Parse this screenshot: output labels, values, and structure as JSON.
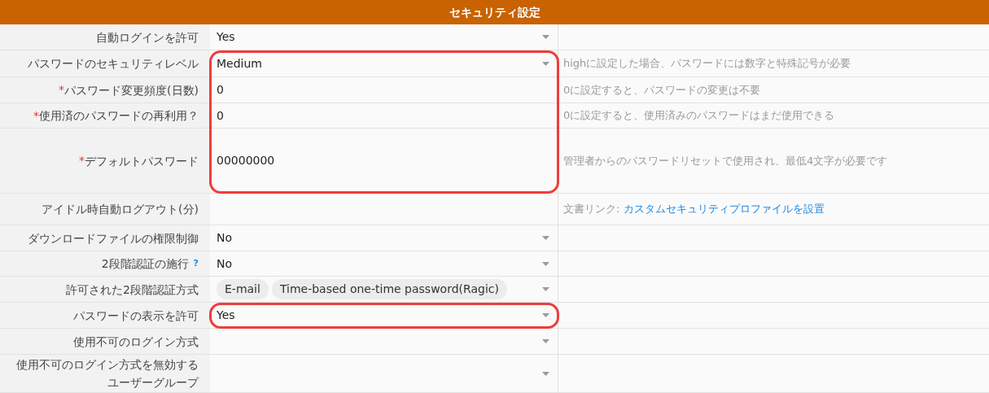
{
  "header": {
    "title": "セキュリティ設定"
  },
  "rows": [
    {
      "label": "自動ログインを許可",
      "kind": "select",
      "value": "Yes",
      "highlighted": false
    },
    {
      "label": "パスワードのセキュリティレベル",
      "kind": "select",
      "value": "Medium",
      "highlighted": true,
      "note": {
        "text": "highに設定した場合、パスワードには数字と特殊記号が必要"
      }
    },
    {
      "marker": "*",
      "label": "パスワード変更頻度(日数)",
      "kind": "input",
      "value": "0",
      "highlighted": true,
      "note": {
        "text": "0に設定すると、パスワードの変更は不要"
      }
    },
    {
      "marker": "*",
      "label": "使用済のパスワードの再利用？",
      "kind": "input",
      "value": "0",
      "highlighted": true,
      "note": {
        "text": "0に設定すると、使用済みのパスワードはまだ使用できる"
      }
    },
    {
      "marker": "*",
      "label": "デフォルトパスワード",
      "kind": "input",
      "value": "00000000",
      "highlighted": true,
      "note": {
        "text": "管理者からのパスワードリセットで使用され、最低4文字が必要です"
      }
    },
    {
      "label": "アイドル時自動ログアウト(分)",
      "kind": "input",
      "highlighted": false,
      "note": {
        "text": "文書リンク:",
        "link": "カスタムセキュリティプロファイルを設置"
      }
    },
    {
      "label": "ダウンロードファイルの権限制御",
      "kind": "select",
      "value": "No",
      "highlighted": false
    },
    {
      "label": "2段階認証の施行",
      "help": "?",
      "kind": "select",
      "value": "No",
      "highlighted": false
    },
    {
      "label": "許可された2段階認証方式",
      "kind": "tags",
      "tags": [
        "E-mail",
        "Time-based one-time password(Ragic)"
      ],
      "highlighted": false
    },
    {
      "label": "パスワードの表示を許可",
      "kind": "select",
      "value": "Yes",
      "highlighted": true
    },
    {
      "label": "使用不可のログイン方式",
      "kind": "select",
      "highlighted": false
    },
    {
      "label": "使用不可のログイン方式を無効するユーザーグループ",
      "kind": "select",
      "highlighted": false
    }
  ]
}
